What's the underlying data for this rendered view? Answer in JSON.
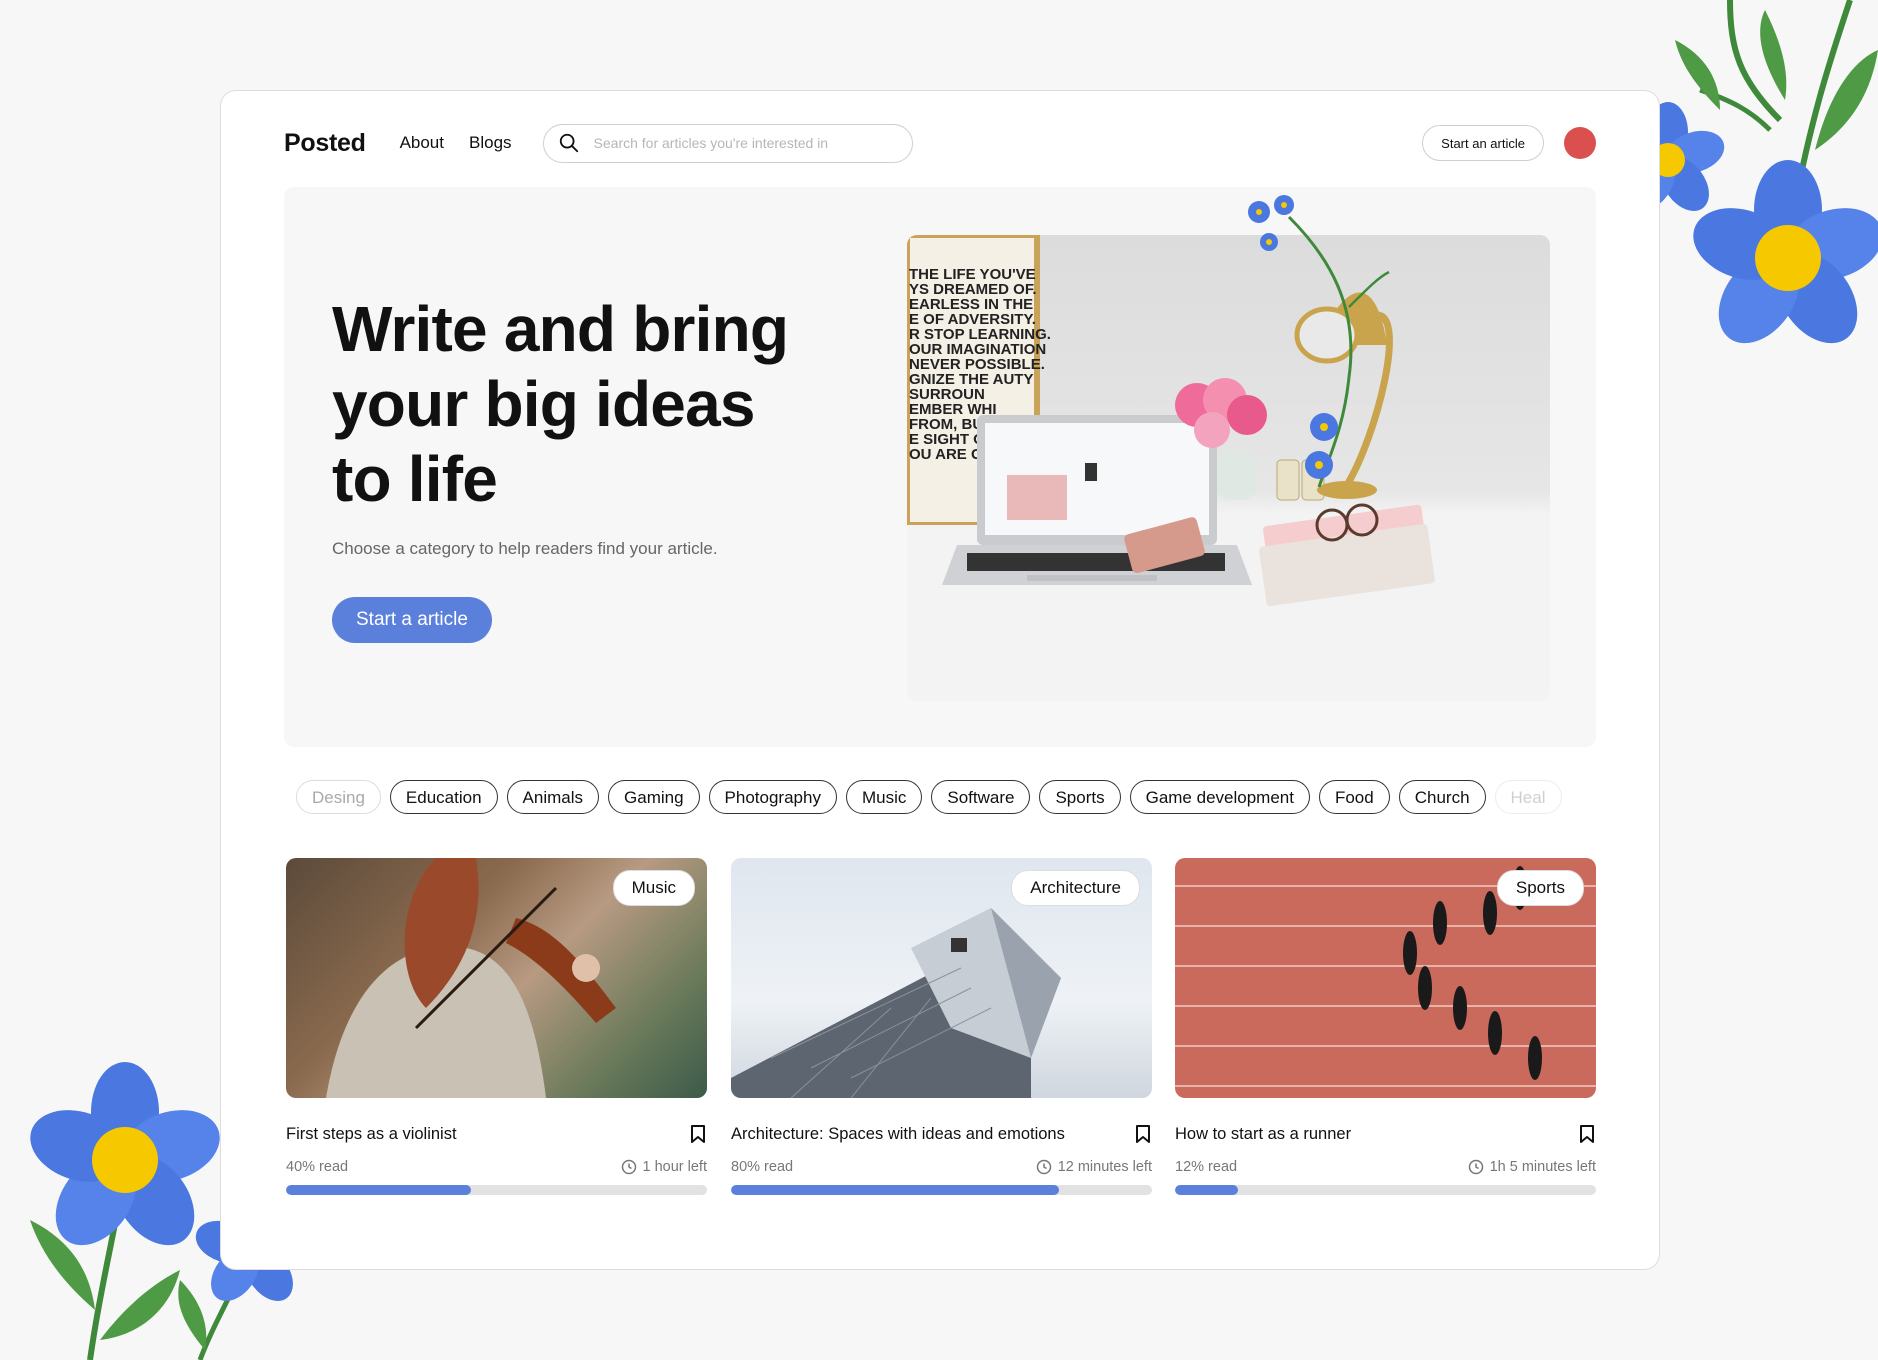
{
  "nav": {
    "logo": "Posted",
    "links": [
      "About",
      "Blogs"
    ],
    "search_placeholder": "Search for articles you're interested in",
    "start_button": "Start an article"
  },
  "hero": {
    "title": "Write and bring your big ideas to life",
    "subtitle": "Choose a category to help readers find your article.",
    "cta": "Start a article",
    "poster_text": [
      "THE LIFE YOU'VE",
      "YS DREAMED OF.",
      "EARLESS IN THE",
      "E OF ADVERSITY.",
      "R STOP LEARNING.",
      "OUR IMAGINATION",
      "NEVER POSSIBLE.",
      "GNIZE THE  AUTY",
      "SURROUN",
      "EMBER WHI",
      "FROM, BU",
      "E SIGHT OF",
      "OU ARE GO"
    ]
  },
  "categories": [
    "Desing",
    "Education",
    "Animals",
    "Gaming",
    "Photography",
    "Music",
    "Software",
    "Sports",
    "Game development",
    "Food",
    "Church",
    "Heal"
  ],
  "cards": [
    {
      "tag": "Music",
      "title": "First steps as a violinist",
      "read_label": "40% read",
      "time_left": "1 hour left",
      "progress": 0.44
    },
    {
      "tag": "Architecture",
      "title": "Architecture: Spaces with ideas and emotions",
      "read_label": "80% read",
      "time_left": "12 minutes left",
      "progress": 0.78
    },
    {
      "tag": "Sports",
      "title": "How to start as a runner",
      "read_label": "12% read",
      "time_left": "1h 5 minutes left",
      "progress": 0.15
    }
  ],
  "colors": {
    "accent": "#5a80dc",
    "avatar": "#d9504f",
    "flower": "#4a78e0",
    "flower_center": "#f5c800"
  },
  "icons": [
    "search-icon",
    "bookmark-icon",
    "clock-icon",
    "avatar"
  ]
}
